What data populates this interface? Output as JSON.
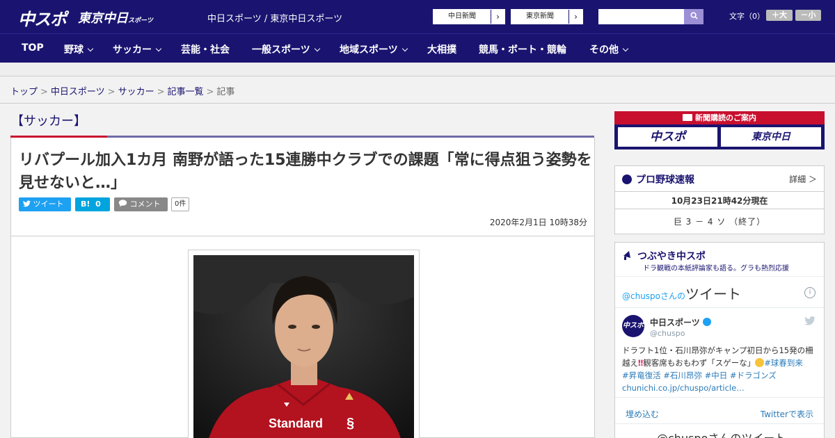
{
  "header": {
    "logo_chuspo": "中スポ",
    "logo_tokyo": "東京中日",
    "logo_tokyo_small": "スポーツ",
    "site_link": "中日スポーツ / 東京中日スポーツ",
    "btn_chunichi": "中日新聞",
    "btn_tokyo": "東京新聞",
    "search_placeholder": "",
    "fontsize_label": "文字（0）",
    "fontsize_bigger": "＋大",
    "fontsize_smaller": "－小"
  },
  "nav": {
    "items": [
      {
        "label": "TOP",
        "has_dropdown": false
      },
      {
        "label": "野球",
        "has_dropdown": true
      },
      {
        "label": "サッカー",
        "has_dropdown": true
      },
      {
        "label": "芸能・社会",
        "has_dropdown": false
      },
      {
        "label": "一般スポーツ",
        "has_dropdown": true
      },
      {
        "label": "地域スポーツ",
        "has_dropdown": true
      },
      {
        "label": "大相撲",
        "has_dropdown": false
      },
      {
        "label": "競馬・ボート・競輪",
        "has_dropdown": false
      },
      {
        "label": "その他",
        "has_dropdown": true
      }
    ]
  },
  "breadcrumb": {
    "items": [
      "トップ",
      "中日スポーツ",
      "サッカー",
      "記事一覧"
    ],
    "separator": ">",
    "current": "記事"
  },
  "article": {
    "category": "【サッカー】",
    "headline": "リバプール加入1カ月 南野が語った15連勝中クラブでの課題「常に得点狙う姿勢を見せないと…」",
    "tweet_label": "ツイート",
    "hatena_label": "B!",
    "hatena_count": "0",
    "comment_label": "コメント",
    "comment_count": "0件",
    "published": "2020年2月1日 10時38分"
  },
  "sidebar": {
    "promo_title": "新聞購読のご案内",
    "promo_chuspo": "中スポ",
    "promo_tokyo": "東京中日",
    "baseball_title": "プロ野球速報",
    "baseball_detail": "詳細 ＞",
    "baseball_time": "10月23日21時42分現在",
    "baseball_score": "巨 3 － 4 ソ （終了）",
    "tsubuyaki_title": "つぶやき中スポ",
    "tsubuyaki_sub": "ドラ観戦の本紙評論家も語る。グラも熱烈応援",
    "tweets_prefix": "@chuspoさんの",
    "tweets_title": "ツイート",
    "account_name": "中日スポーツ",
    "account_handle": "@chuspo",
    "avatar_text": "中スポ",
    "tweet_text_1": "ドラフト1位・石川昂弥がキャンプ初日から15発の柵越え",
    "tweet_text_2": "観客席もおもわず「スゲーな」",
    "tweet_hashtag_1": "#球春到来",
    "tweet_hashtags_2": "#昇竜復活 #石川昂弥 #中日 #ドラゴンズ",
    "tweet_link": "chunichi.co.jp/chuspo/article…",
    "embed_label": "埋め込む",
    "view_on_twitter": "Twitterで表示",
    "footer_text": "@chuspoさんのツイート"
  },
  "colors": {
    "brand_navy": "#1a1470",
    "accent_red": "#c8102e",
    "twitter_blue": "#1da1f2",
    "hatena_blue": "#00a4de"
  }
}
